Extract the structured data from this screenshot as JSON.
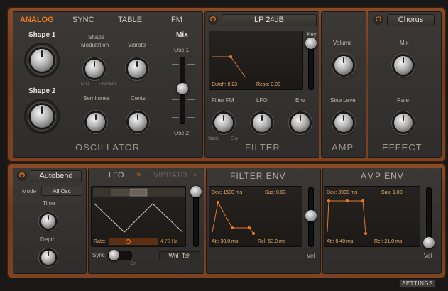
{
  "osc_tabs": [
    {
      "label": "ANALOG",
      "active": true
    },
    {
      "label": "SYNC",
      "active": false
    },
    {
      "label": "TABLE",
      "active": false
    },
    {
      "label": "FM",
      "active": false
    }
  ],
  "osc": {
    "shape1": "Shape 1",
    "shape2": "Shape 2",
    "shape_mod": "Shape\nModulation",
    "shape_mod_l1": "Shape",
    "shape_mod_l2": "Modulation",
    "lfo": "LFO",
    "filter_env": "Filter Env",
    "vibrato": "Vibrato",
    "mix": "Mix",
    "osc1": "Osc 1",
    "osc2": "Osc 2",
    "semitones": "Semitones",
    "cents": "Cents",
    "title": "OSCILLATOR"
  },
  "filter": {
    "type": "LP 24dB",
    "key": "Key",
    "cutoff_label": "Cutoff:",
    "cutoff": "0.23",
    "reso_label": "Reso:",
    "reso": "0.00",
    "fm": "Filter FM",
    "lfo": "LFO",
    "env": "Env",
    "static": "Static",
    "env_small": "Env",
    "title": "FILTER"
  },
  "amp": {
    "volume": "Volume",
    "sine_level": "Sine Level",
    "title": "AMP"
  },
  "effect": {
    "type": "Chorus",
    "mix": "Mix",
    "rate": "Rate",
    "title": "EFFECT"
  },
  "autobend": {
    "title": "Autobend",
    "mode_label": "Mode",
    "mode": "All Osc",
    "time": "Time",
    "depth": "Depth"
  },
  "lfo": {
    "tab_lfo": "LFO",
    "tab_vibrato": "VIBRATO",
    "rate_label": "Rate:",
    "rate": "4.70 Hz",
    "sync": "Sync",
    "on": "On",
    "trigger": "Whl+Tch"
  },
  "filter_env": {
    "title": "FILTER ENV",
    "dec_label": "Dec:",
    "dec": "1500 ms",
    "sus_label": "Sus:",
    "sus": "0.03",
    "att_label": "Att:",
    "att": "30.0 ms",
    "rel_label": "Rel:",
    "rel": "53.0 ms",
    "vel": "Vel"
  },
  "amp_env": {
    "title": "AMP ENV",
    "dec_label": "Dec:",
    "dec": "3900 ms",
    "sus_label": "Sus:",
    "sus": "1.00",
    "att_label": "Att:",
    "att": "0.40 ms",
    "rel_label": "Rel:",
    "rel": "21.0 ms",
    "vel": "Vel"
  },
  "settings": "SETTINGS",
  "colors": {
    "accent": "#f07a22",
    "wood": "#7d4322"
  }
}
